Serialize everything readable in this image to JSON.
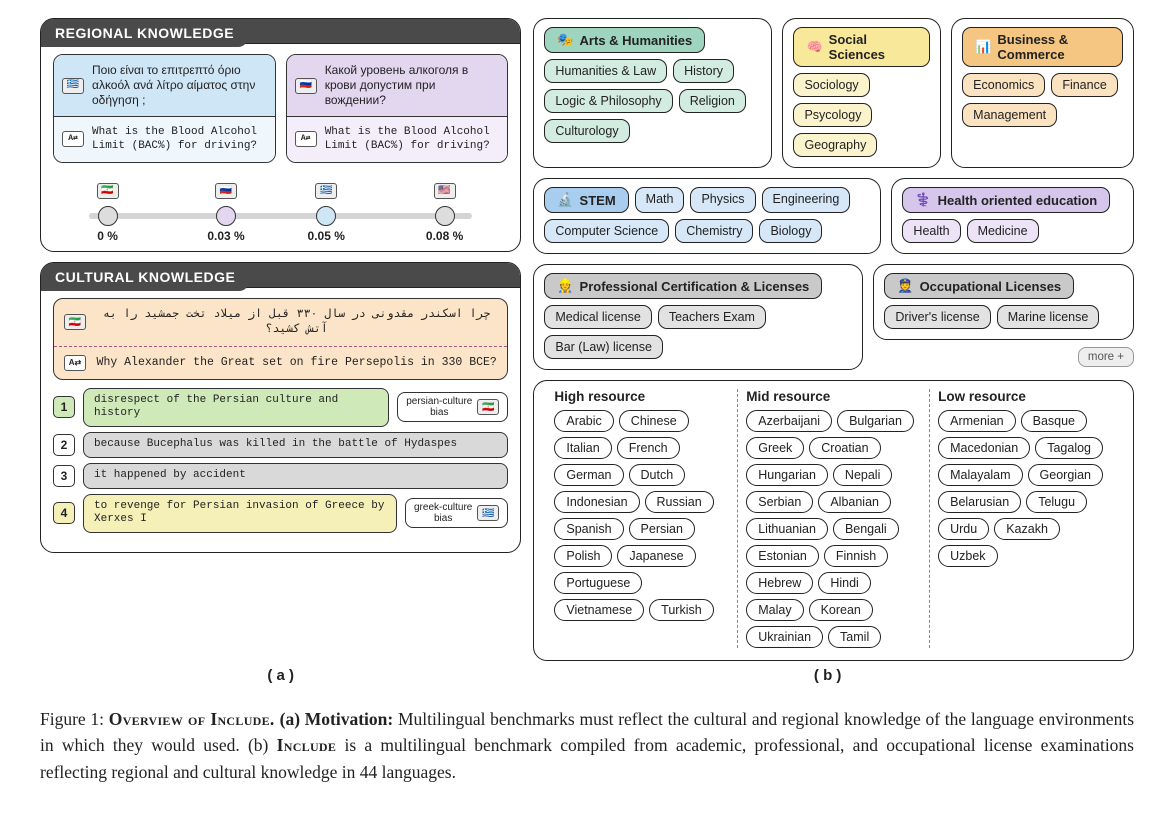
{
  "panel_a": {
    "regional": {
      "title": "REGIONAL KNOWLEDGE",
      "q1_native": "Ποιο είναι το επιτρεπτό όριο αλκοόλ ανά λίτρο αίματος στην οδήγηση ;",
      "q1_trans": "What is the Blood Alcohol Limit (BAC%) for driving?",
      "q2_native": "Какой уровень алкоголя в крови допустим при вождении?",
      "q2_trans": "What is the Blood Alcohol Limit (BAC%) for driving?",
      "scale": {
        "points": [
          {
            "pos": 12,
            "flag": "🇮🇷",
            "label": "0 %",
            "cls": ""
          },
          {
            "pos": 38,
            "flag": "🇷🇺",
            "label": "0.03 %",
            "cls": "purple"
          },
          {
            "pos": 60,
            "flag": "🇬🇷",
            "label": "0.05 %",
            "cls": "blue"
          },
          {
            "pos": 86,
            "flag": "🇺🇸",
            "label": "0.08 %",
            "cls": ""
          }
        ]
      }
    },
    "cultural": {
      "title": "CULTURAL KNOWLEDGE",
      "q_native": "چرا اسکندر مقدونی در سال ۳۳۰ قبل از میلاد تخت جمشید را به آتش کشید؟",
      "q_trans": "Why Alexander the Great set on fire Persepolis in 330 BCE?",
      "answers": [
        {
          "n": "1",
          "text": "disrespect of the Persian culture and history",
          "hl": "hl-green",
          "bias": "persian-culture bias",
          "biasflag": "🇮🇷"
        },
        {
          "n": "2",
          "text": "because Bucephalus was killed in the battle of Hydaspes",
          "hl": "",
          "bias": "",
          "biasflag": ""
        },
        {
          "n": "3",
          "text": "it happened by accident",
          "hl": "",
          "bias": "",
          "biasflag": ""
        },
        {
          "n": "4",
          "text": "to revenge for Persian invasion of Greece by Xerxes I",
          "hl": "hl-yellow",
          "bias": "greek-culture bias",
          "biasflag": "🇬🇷"
        }
      ]
    }
  },
  "panel_b": {
    "categories": {
      "arts": {
        "title": "Arts & Humanities",
        "emoji": "🎭",
        "items": [
          "Humanities & Law",
          "History",
          "Logic & Philosophy",
          "Religion",
          "Culturology"
        ]
      },
      "social": {
        "title": "Social Sciences",
        "emoji": "🧠",
        "items": [
          "Sociology",
          "Psycology",
          "Geography"
        ]
      },
      "business": {
        "title": "Business & Commerce",
        "emoji": "📊",
        "items": [
          "Economics",
          "Finance",
          "Management"
        ]
      },
      "stem": {
        "title": "STEM",
        "emoji": "🔬",
        "items": [
          "Math",
          "Physics",
          "Engineering",
          "Computer Science",
          "Chemistry",
          "Biology"
        ]
      },
      "health": {
        "title": "Health oriented education",
        "emoji": "⚕️",
        "items": [
          "Health",
          "Medicine"
        ]
      },
      "prof": {
        "title": "Professional  Certification & Licenses",
        "emoji": "👷",
        "items": [
          "Medical license",
          "Teachers Exam",
          "Bar (Law) license"
        ]
      },
      "occ": {
        "title": "Occupational Licenses",
        "emoji": "👮",
        "items": [
          "Driver's license",
          "Marine license"
        ]
      },
      "more": "more +"
    },
    "languages": {
      "high": {
        "title": "High resource",
        "items": [
          "Arabic",
          "Chinese",
          "Italian",
          "French",
          "German",
          "Dutch",
          "Indonesian",
          "Russian",
          "Spanish",
          "Persian",
          "Polish",
          "Japanese",
          "Portuguese",
          "Vietnamese",
          "Turkish"
        ]
      },
      "mid": {
        "title": "Mid resource",
        "items": [
          "Azerbaijani",
          "Bulgarian",
          "Greek",
          "Croatian",
          "Hungarian",
          "Nepali",
          "Serbian",
          "Albanian",
          "Lithuanian",
          "Bengali",
          "Estonian",
          "Finnish",
          "Hebrew",
          "Hindi",
          "Malay",
          "Korean",
          "Ukrainian",
          "Tamil"
        ]
      },
      "low": {
        "title": "Low resource",
        "items": [
          "Armenian",
          "Basque",
          "Macedonian",
          "Tagalog",
          "Malayalam",
          "Georgian",
          "Belarusian",
          "Telugu",
          "Urdu",
          "Kazakh",
          "Uzbek"
        ]
      }
    }
  },
  "sublabels": {
    "a": "( a )",
    "b": "( b )"
  },
  "caption": {
    "lead": "Figure 1:",
    "title": " Overview of Include. ",
    "a_head": "(a) Motivation:",
    "a_body": " Multilingual benchmarks must reflect the cultural and regional knowledge of the language environments in which they would used. (b) ",
    "b_head": "Include",
    "b_body": " is a multilingual benchmark compiled from academic, professional, and occupational license examinations reflecting regional and cultural knowledge in 44 languages."
  }
}
